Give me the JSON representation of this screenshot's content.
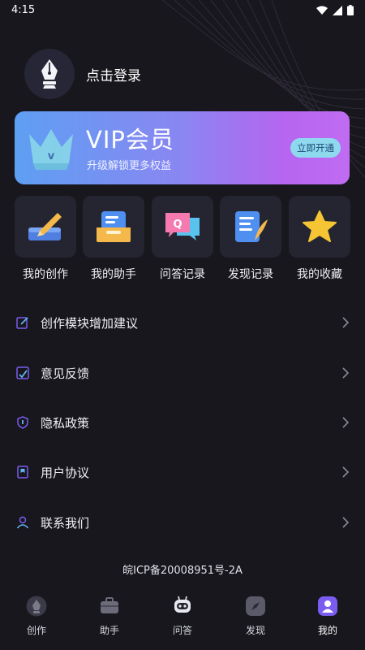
{
  "status_bar": {
    "time": "4:15"
  },
  "profile": {
    "login_label": "点击登录"
  },
  "vip": {
    "title": "VIP会员",
    "subtitle": "升级解锁更多权益",
    "button_label": "立即开通",
    "badge_letter": "v"
  },
  "shortcuts": [
    {
      "label": "我的创作",
      "icon": "pen-paper-icon"
    },
    {
      "label": "我的助手",
      "icon": "assistant-box-icon"
    },
    {
      "label": "问答记录",
      "icon": "qa-chat-icon"
    },
    {
      "label": "发现记录",
      "icon": "document-quill-icon"
    },
    {
      "label": "我的收藏",
      "icon": "star-icon"
    }
  ],
  "menu": [
    {
      "label": "创作模块增加建议",
      "icon": "edit-icon"
    },
    {
      "label": "意见反馈",
      "icon": "feedback-icon"
    },
    {
      "label": "隐私政策",
      "icon": "shield-icon"
    },
    {
      "label": "用户协议",
      "icon": "bookmark-icon"
    },
    {
      "label": "联系我们",
      "icon": "user-icon"
    }
  ],
  "footer": {
    "icp": "皖ICP备20008951号-2A"
  },
  "tabs": [
    {
      "label": "创作",
      "icon": "pen-nib-icon",
      "active": false
    },
    {
      "label": "助手",
      "icon": "briefcase-icon",
      "active": false
    },
    {
      "label": "问答",
      "icon": "robot-icon",
      "active": false
    },
    {
      "label": "发现",
      "icon": "compass-icon",
      "active": false
    },
    {
      "label": "我的",
      "icon": "profile-icon",
      "active": true
    }
  ],
  "colors": {
    "background": "#17171d",
    "tile": "#252532",
    "accent_purple": "#7b5cf0",
    "vip_gradient_start": "#5e9ff2",
    "vip_gradient_end": "#c06cf2",
    "vip_button": "#8fd9ee"
  }
}
